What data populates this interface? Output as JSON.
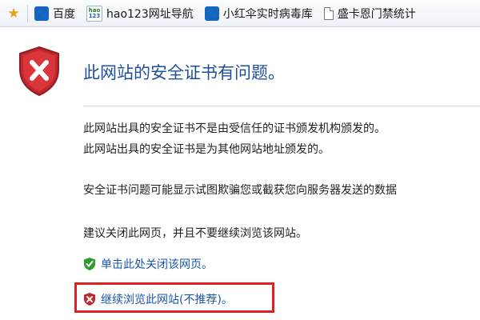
{
  "favorites": {
    "items": [
      {
        "label": "百度",
        "icon": "baidu-paw-icon"
      },
      {
        "label": "hao123网址导航",
        "icon": "hao123-icon",
        "icon_text_top": "hao",
        "icon_text_bottom": "123"
      },
      {
        "label": "小红伞实时病毒库",
        "icon": "paw-icon"
      },
      {
        "label": "盛卡恩门禁统计",
        "icon": "page-icon"
      }
    ]
  },
  "page": {
    "title": "此网站的安全证书有问题。",
    "lines": [
      "此网站出具的安全证书不是由受信任的证书颁发机构颁发的。",
      "此网站出具的安全证书是为其他网站地址颁发的。",
      "安全证书问题可能显示试图欺骗您或截获您向服务器发送的数据",
      "建议关闭此网页，并且不要继续浏览该网站。"
    ],
    "close_link": "单击此处关闭该网页。",
    "continue_link": "继续浏览此网站(不推荐)。"
  },
  "colors": {
    "title": "#1f4f99",
    "link": "#1a56a8",
    "highlight": "#e02020",
    "shield_red": "#c0282d",
    "shield_green": "#2f9a2f"
  }
}
